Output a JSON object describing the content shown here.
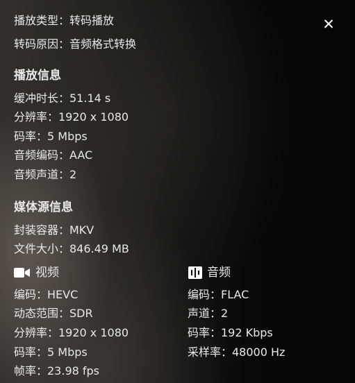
{
  "playback": {
    "type_label": "播放类型：",
    "type_value": "转码播放",
    "reason_label": "转码原因：",
    "reason_value": "音频格式转换"
  },
  "playback_info": {
    "heading": "播放信息",
    "buffer": "缓冲时长：51.14 s",
    "resolution": "分辨率：1920 x 1080",
    "bitrate": "码率：5 Mbps",
    "audio_codec": "音频编码：AAC",
    "audio_channels": "音频声道：2"
  },
  "media_info": {
    "heading": "媒体源信息",
    "container": "封装容器：MKV",
    "file_size": "文件大小：846.49 MB"
  },
  "video": {
    "heading": "视频",
    "icon": "video-camera-icon",
    "codec": "编码：HEVC",
    "dynamic_range": "动态范围：SDR",
    "resolution": "分辨率：1920 x 1080",
    "bitrate": "码率：5 Mbps",
    "framerate": "帧率：23.98 fps"
  },
  "audio": {
    "heading": "音频",
    "icon": "audio-waveform-icon",
    "codec": "编码：FLAC",
    "channels": "声道：2",
    "bitrate": "码率：192 Kbps",
    "sample_rate": "采样率：48000 Hz"
  },
  "close_icon": "close-icon",
  "colors": {
    "text": "#e9e9e9",
    "heading": "#ffffff"
  }
}
